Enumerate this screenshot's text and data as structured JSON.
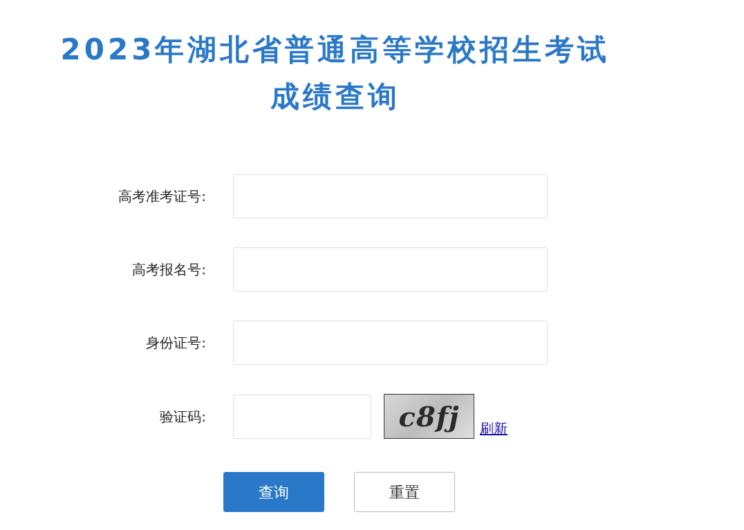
{
  "title": [
    "2023年湖北省普通高等学校招生考试",
    "成绩查询"
  ],
  "fields": [
    {
      "label": "高考准考证号:"
    },
    {
      "label": "高考报名号:"
    },
    {
      "label": "身份证号:"
    }
  ],
  "captcha": {
    "label": "验证码:",
    "image_text": "c8fj",
    "refresh": "刷新"
  },
  "buttons": [
    {
      "label": "查询",
      "kind": "primary"
    },
    {
      "label": "重置",
      "kind": "secondary"
    }
  ]
}
